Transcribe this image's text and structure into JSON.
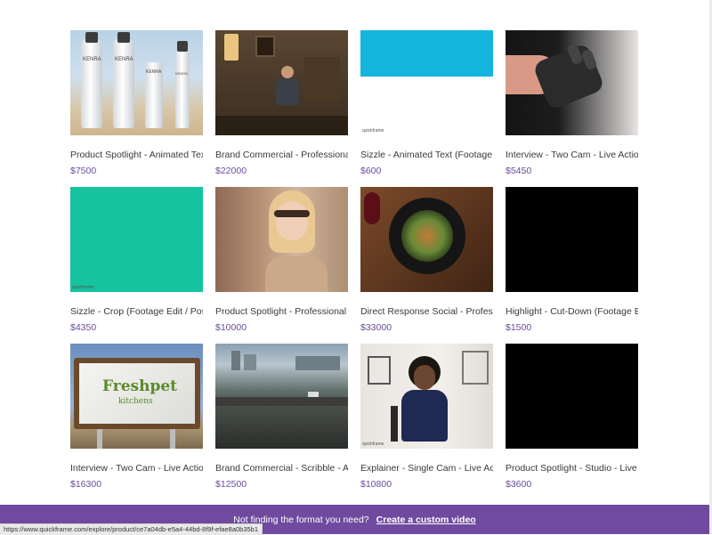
{
  "products": [
    {
      "title": "Product Spotlight - Animated Text (Fo",
      "price": "$7500",
      "thumb": "shampoo",
      "bottle_labels": [
        "KENRA",
        "KENRA",
        "KENRA",
        "KENRA"
      ]
    },
    {
      "title": "Brand Commercial - Professional - Liv",
      "price": "$22000",
      "thumb": "room"
    },
    {
      "title": "Sizzle - Animated Text (Footage Edit /",
      "price": "$600",
      "thumb": "blue",
      "watermark": "quickframe"
    },
    {
      "title": "Interview - Two Cam - Live Action",
      "price": "$5450",
      "thumb": "hand"
    },
    {
      "title": "Sizzle - Crop (Footage Edit / Post-Proc",
      "price": "$4350",
      "thumb": "teal",
      "watermark": "quickframe"
    },
    {
      "title": "Product Spotlight - Professional - Live",
      "price": "$10000",
      "thumb": "woman"
    },
    {
      "title": "Direct Response Social - Professional",
      "price": "$33000",
      "thumb": "food"
    },
    {
      "title": "Highlight - Cut-Down (Footage Edit / I",
      "price": "$1500",
      "thumb": "black"
    },
    {
      "title": "Interview - Two Cam - Live Action",
      "price": "$16300",
      "thumb": "sign",
      "sign_text": "Freshpet",
      "sign_sub": "kitchens"
    },
    {
      "title": "Brand Commercial - Scribble - Animat",
      "price": "$12500",
      "thumb": "city"
    },
    {
      "title": "Explainer - Single Cam - Live Action",
      "price": "$10800",
      "thumb": "woman2",
      "watermark": "quickframe"
    },
    {
      "title": "Product Spotlight - Studio - Live Actio",
      "price": "$3600",
      "thumb": "black"
    }
  ],
  "banner": {
    "text": "Not finding the format you need?",
    "cta": "Create a custom video"
  },
  "status_bar": {
    "url": "https://www.quickframe.com/explore/product/ce7a04db-e5a4-44bd-8f9f-efae8a0b35b1"
  },
  "colors": {
    "price": "#6a4c9c",
    "banner": "#6f4a9f",
    "teal": "#15c39e",
    "blue": "#13b5dd"
  }
}
